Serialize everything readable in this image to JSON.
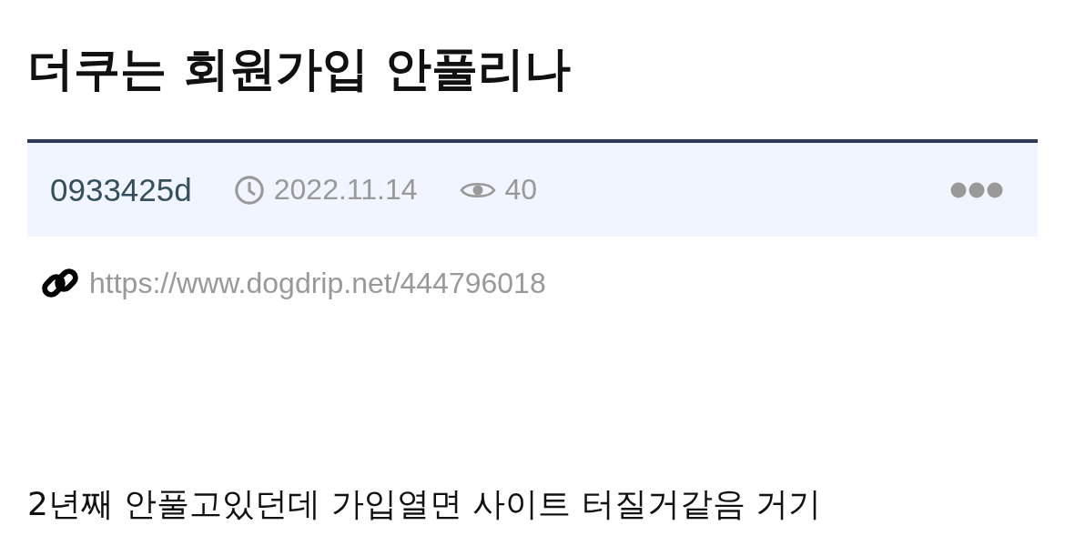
{
  "post": {
    "title": "더쿠는 회원가입 안풀리나",
    "author": "0933425d",
    "date": "2022.11.14",
    "views": "40",
    "url": "https://www.dogdrip.net/444796018",
    "body": "2년째 안풀고있던데 가입열면 사이트 터질거같음 거기"
  }
}
